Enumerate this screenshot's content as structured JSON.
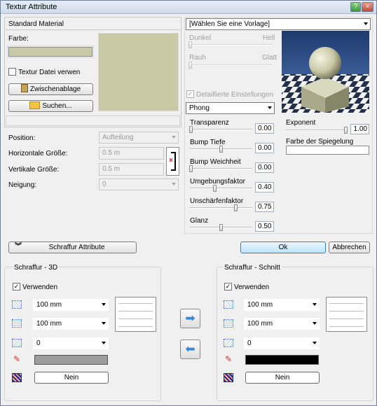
{
  "window": {
    "title": "Textur Attribute"
  },
  "left": {
    "material_name": "Standard Material",
    "farbe_label": "Farbe:",
    "colors": {
      "material": "#c9c9a6",
      "preview_bg": "#c9c9a6"
    },
    "texture_checkbox_label": "Textur Datei verwen",
    "clipboard_button": "Zwischenablage",
    "search_button": "Suchen...",
    "position_label": "Position:",
    "position_value": "Aufteilung",
    "hsize_label": "Horizontale Größe:",
    "hsize_value": "0.5 m",
    "vsize_label": "Vertikale Größe:",
    "vsize_value": "0.5 m",
    "tilt_label": "Neigung:",
    "tilt_value": "0"
  },
  "right": {
    "preset_value": "[Wählen Sie eine Vorlage]",
    "dark_label": "Dunkel",
    "light_label": "Hell",
    "rough_label": "Rauh",
    "smooth_label": "Glatt",
    "detailed_label": "Detaillierte Einstellungen",
    "shading_value": "Phong",
    "params": [
      {
        "label": "Transparenz",
        "value": "0.00",
        "level": 0.0
      },
      {
        "label": "Bump Tiefe",
        "value": "0.00",
        "level": 0.5
      },
      {
        "label": "Bump Weichheit",
        "value": "0.00",
        "level": 0.0
      },
      {
        "label": "Umgebungsfaktor",
        "value": "0.40",
        "level": 0.4
      },
      {
        "label": "Unschärfenfaktor",
        "value": "0.75",
        "level": 0.75
      },
      {
        "label": "Glanz",
        "value": "0.50",
        "level": 0.5
      }
    ],
    "exponent_label": "Exponent",
    "exponent_value": "1.00",
    "spec_color_label": "Farbe der Spiegelung"
  },
  "bottom": {
    "hatch_button": "Schraffur Attribute",
    "ok_button": "Ok",
    "cancel_button": "Abbrechen",
    "hatch3d": {
      "title": "Schraffur - 3D",
      "use_label": "Verwenden",
      "spacing1": "100 mm",
      "spacing2": "100 mm",
      "angle": "0",
      "pen_color": "#9c9c9c",
      "fill_label": "Nein"
    },
    "hatchcut": {
      "title": "Schraffur - Schnitt",
      "use_label": "Verwenden",
      "spacing1": "100 mm",
      "spacing2": "100 mm",
      "angle": "0",
      "pen_color": "#000000",
      "fill_label": "Nein"
    }
  }
}
